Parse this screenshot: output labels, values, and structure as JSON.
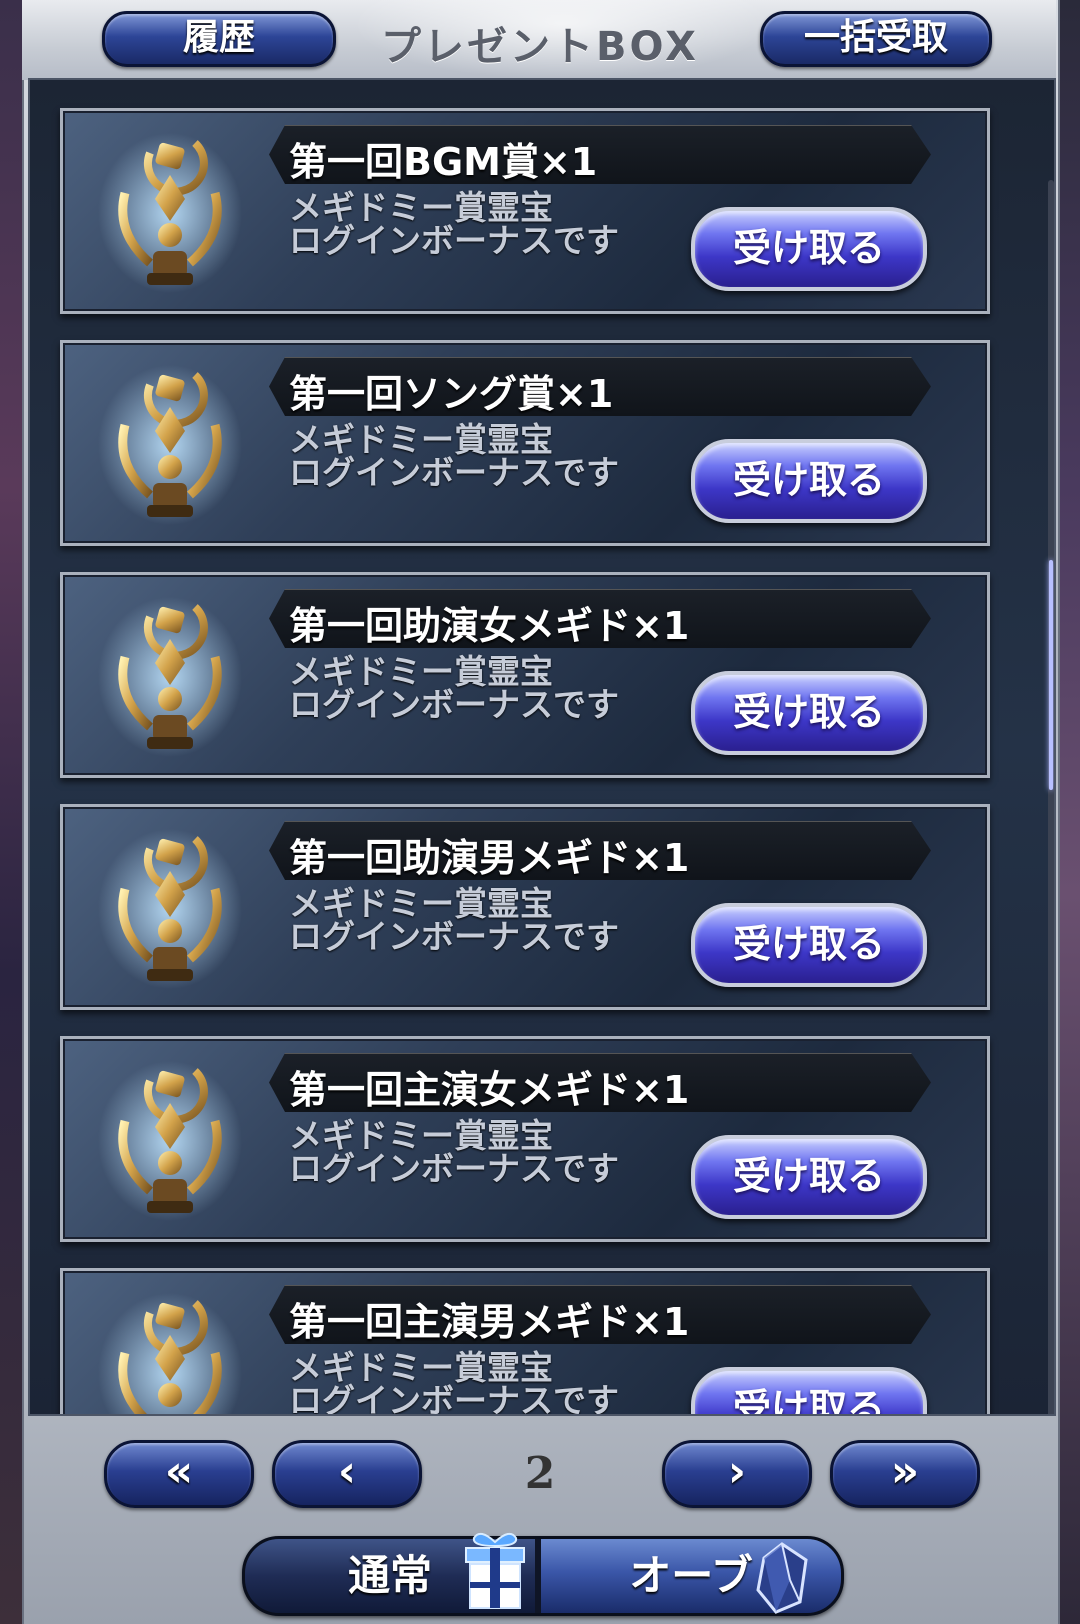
{
  "header": {
    "title": "プレゼントBOX",
    "history_label": "履歴",
    "bulk_receive_label": "一括受取"
  },
  "items": [
    {
      "title": "第一回BGM賞×1",
      "desc_line1": "メギドミー賞霊宝",
      "desc_line2": "ログインボーナスです",
      "button": "受け取る"
    },
    {
      "title": "第一回ソング賞×1",
      "desc_line1": "メギドミー賞霊宝",
      "desc_line2": "ログインボーナスです",
      "button": "受け取る"
    },
    {
      "title": "第一回助演女メギド×1",
      "desc_line1": "メギドミー賞霊宝",
      "desc_line2": "ログインボーナスです",
      "button": "受け取る"
    },
    {
      "title": "第一回助演男メギド×1",
      "desc_line1": "メギドミー賞霊宝",
      "desc_line2": "ログインボーナスです",
      "button": "受け取る"
    },
    {
      "title": "第一回主演女メギド×1",
      "desc_line1": "メギドミー賞霊宝",
      "desc_line2": "ログインボーナスです",
      "button": "受け取る"
    },
    {
      "title": "第一回主演男メギド×1",
      "desc_line1": "メギドミー賞霊宝",
      "desc_line2": "ログインボーナスです",
      "button": "受け取る"
    }
  ],
  "pager": {
    "first_label": "«",
    "prev_label": "‹",
    "page": "2",
    "next_label": "›",
    "last_label": "»"
  },
  "tabs": {
    "normal_label": "通常",
    "orb_label": "オーブ",
    "gift_icon": "gift-icon",
    "orb_icon": "crystal-icon"
  },
  "colors": {
    "button_blue": "#3d37c8",
    "frame_silver": "#c7ccd4",
    "card_navy": "#2f3f58",
    "trophy_gold": "#d2a24a"
  }
}
